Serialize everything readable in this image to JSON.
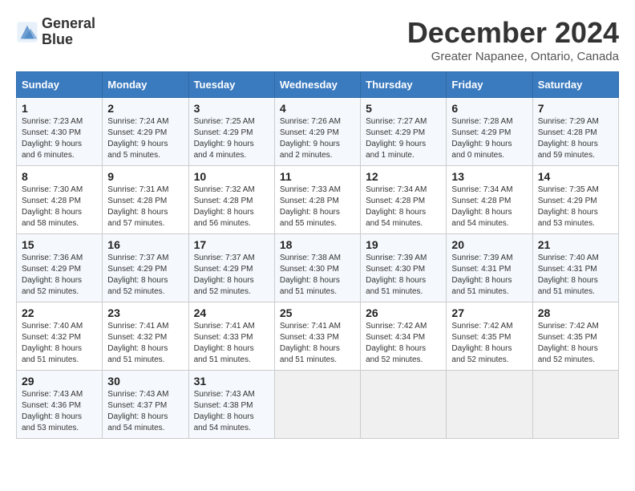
{
  "logo": {
    "line1": "General",
    "line2": "Blue"
  },
  "title": "December 2024",
  "location": "Greater Napanee, Ontario, Canada",
  "days_of_week": [
    "Sunday",
    "Monday",
    "Tuesday",
    "Wednesday",
    "Thursday",
    "Friday",
    "Saturday"
  ],
  "weeks": [
    [
      {
        "day": 1,
        "sunrise": "7:23 AM",
        "sunset": "4:30 PM",
        "daylight": "9 hours and 6 minutes."
      },
      {
        "day": 2,
        "sunrise": "7:24 AM",
        "sunset": "4:29 PM",
        "daylight": "9 hours and 5 minutes."
      },
      {
        "day": 3,
        "sunrise": "7:25 AM",
        "sunset": "4:29 PM",
        "daylight": "9 hours and 4 minutes."
      },
      {
        "day": 4,
        "sunrise": "7:26 AM",
        "sunset": "4:29 PM",
        "daylight": "9 hours and 2 minutes."
      },
      {
        "day": 5,
        "sunrise": "7:27 AM",
        "sunset": "4:29 PM",
        "daylight": "9 hours and 1 minute."
      },
      {
        "day": 6,
        "sunrise": "7:28 AM",
        "sunset": "4:29 PM",
        "daylight": "9 hours and 0 minutes."
      },
      {
        "day": 7,
        "sunrise": "7:29 AM",
        "sunset": "4:28 PM",
        "daylight": "8 hours and 59 minutes."
      }
    ],
    [
      {
        "day": 8,
        "sunrise": "7:30 AM",
        "sunset": "4:28 PM",
        "daylight": "8 hours and 58 minutes."
      },
      {
        "day": 9,
        "sunrise": "7:31 AM",
        "sunset": "4:28 PM",
        "daylight": "8 hours and 57 minutes."
      },
      {
        "day": 10,
        "sunrise": "7:32 AM",
        "sunset": "4:28 PM",
        "daylight": "8 hours and 56 minutes."
      },
      {
        "day": 11,
        "sunrise": "7:33 AM",
        "sunset": "4:28 PM",
        "daylight": "8 hours and 55 minutes."
      },
      {
        "day": 12,
        "sunrise": "7:34 AM",
        "sunset": "4:28 PM",
        "daylight": "8 hours and 54 minutes."
      },
      {
        "day": 13,
        "sunrise": "7:34 AM",
        "sunset": "4:28 PM",
        "daylight": "8 hours and 54 minutes."
      },
      {
        "day": 14,
        "sunrise": "7:35 AM",
        "sunset": "4:29 PM",
        "daylight": "8 hours and 53 minutes."
      }
    ],
    [
      {
        "day": 15,
        "sunrise": "7:36 AM",
        "sunset": "4:29 PM",
        "daylight": "8 hours and 52 minutes."
      },
      {
        "day": 16,
        "sunrise": "7:37 AM",
        "sunset": "4:29 PM",
        "daylight": "8 hours and 52 minutes."
      },
      {
        "day": 17,
        "sunrise": "7:37 AM",
        "sunset": "4:29 PM",
        "daylight": "8 hours and 52 minutes."
      },
      {
        "day": 18,
        "sunrise": "7:38 AM",
        "sunset": "4:30 PM",
        "daylight": "8 hours and 51 minutes."
      },
      {
        "day": 19,
        "sunrise": "7:39 AM",
        "sunset": "4:30 PM",
        "daylight": "8 hours and 51 minutes."
      },
      {
        "day": 20,
        "sunrise": "7:39 AM",
        "sunset": "4:31 PM",
        "daylight": "8 hours and 51 minutes."
      },
      {
        "day": 21,
        "sunrise": "7:40 AM",
        "sunset": "4:31 PM",
        "daylight": "8 hours and 51 minutes."
      }
    ],
    [
      {
        "day": 22,
        "sunrise": "7:40 AM",
        "sunset": "4:32 PM",
        "daylight": "8 hours and 51 minutes."
      },
      {
        "day": 23,
        "sunrise": "7:41 AM",
        "sunset": "4:32 PM",
        "daylight": "8 hours and 51 minutes."
      },
      {
        "day": 24,
        "sunrise": "7:41 AM",
        "sunset": "4:33 PM",
        "daylight": "8 hours and 51 minutes."
      },
      {
        "day": 25,
        "sunrise": "7:41 AM",
        "sunset": "4:33 PM",
        "daylight": "8 hours and 51 minutes."
      },
      {
        "day": 26,
        "sunrise": "7:42 AM",
        "sunset": "4:34 PM",
        "daylight": "8 hours and 52 minutes."
      },
      {
        "day": 27,
        "sunrise": "7:42 AM",
        "sunset": "4:35 PM",
        "daylight": "8 hours and 52 minutes."
      },
      {
        "day": 28,
        "sunrise": "7:42 AM",
        "sunset": "4:35 PM",
        "daylight": "8 hours and 52 minutes."
      }
    ],
    [
      {
        "day": 29,
        "sunrise": "7:43 AM",
        "sunset": "4:36 PM",
        "daylight": "8 hours and 53 minutes."
      },
      {
        "day": 30,
        "sunrise": "7:43 AM",
        "sunset": "4:37 PM",
        "daylight": "8 hours and 54 minutes."
      },
      {
        "day": 31,
        "sunrise": "7:43 AM",
        "sunset": "4:38 PM",
        "daylight": "8 hours and 54 minutes."
      },
      null,
      null,
      null,
      null
    ]
  ]
}
